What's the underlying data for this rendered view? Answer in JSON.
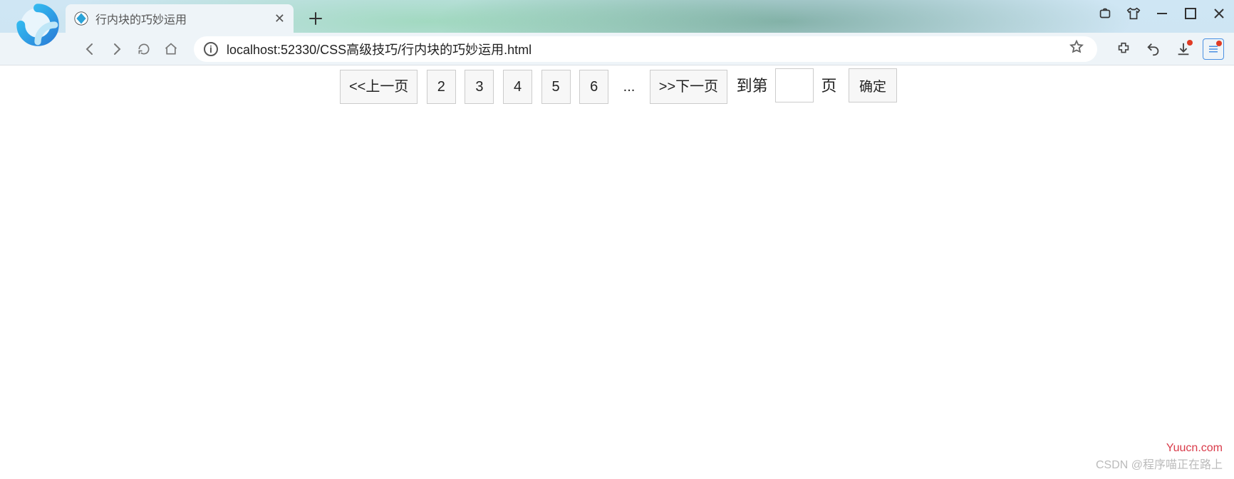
{
  "window": {
    "tab_title": "行内块的巧妙运用",
    "address": "localhost:52330/CSS高级技巧/行内块的巧妙运用.html"
  },
  "icons": {
    "info": "i"
  },
  "pagination": {
    "prev": "<<上一页",
    "next": ">>下一页",
    "pages": [
      "2",
      "3",
      "4",
      "5",
      "6"
    ],
    "dots": "...",
    "goto_prefix": "到第",
    "goto_suffix": "页",
    "goto_value": "",
    "confirm": "确定"
  },
  "watermark": {
    "site": "Yuucn.com",
    "credit": "CSDN @程序喵正在路上"
  }
}
